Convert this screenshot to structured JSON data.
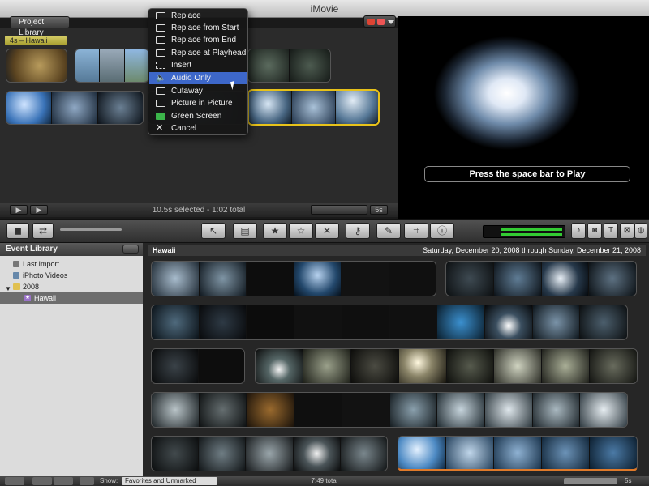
{
  "window": {
    "title": "iMovie"
  },
  "project": {
    "library_button": "Project Library",
    "title_tag": "4s – Hawaii",
    "status": "10.5s selected - 1:02 total",
    "zoom_value": "5s"
  },
  "viewer": {
    "hint": "Press the space bar to Play"
  },
  "context_menu": {
    "items": [
      {
        "label": "Replace",
        "icon": "replace-icon"
      },
      {
        "label": "Replace from Start",
        "icon": "replace-start-icon"
      },
      {
        "label": "Replace from End",
        "icon": "replace-end-icon"
      },
      {
        "label": "Replace at Playhead",
        "icon": "replace-playhead-icon"
      },
      {
        "label": "Insert",
        "icon": "insert-icon"
      },
      {
        "label": "Audio Only",
        "icon": "speaker-icon"
      },
      {
        "label": "Cutaway",
        "icon": "cutaway-icon"
      },
      {
        "label": "Picture in Picture",
        "icon": "pip-icon"
      },
      {
        "label": "Green Screen",
        "icon": "green-screen-icon"
      },
      {
        "label": "Cancel",
        "icon": "close-icon"
      }
    ],
    "highlighted": "Audio Only"
  },
  "event_library": {
    "title": "Event Library",
    "items": [
      {
        "label": "Last Import",
        "icon": "clock-icon"
      },
      {
        "label": "iPhoto Videos",
        "icon": "iphoto-icon"
      },
      {
        "label": "2008",
        "icon": "folder-icon"
      },
      {
        "label": "Hawaii",
        "icon": "star-icon"
      }
    ]
  },
  "browser": {
    "event_name": "Hawaii",
    "date_range": "Saturday, December 20, 2008 through Sunday, December 21, 2008"
  },
  "statusbar": {
    "show_label": "Show:",
    "filter_value": "Favorites and Unmarked",
    "total": "7:49 total",
    "zoom_value": "5s"
  },
  "colors": {
    "accent": "#3d67c9",
    "selection": "#e7c21a",
    "title_tag": "#c8bf4b"
  }
}
